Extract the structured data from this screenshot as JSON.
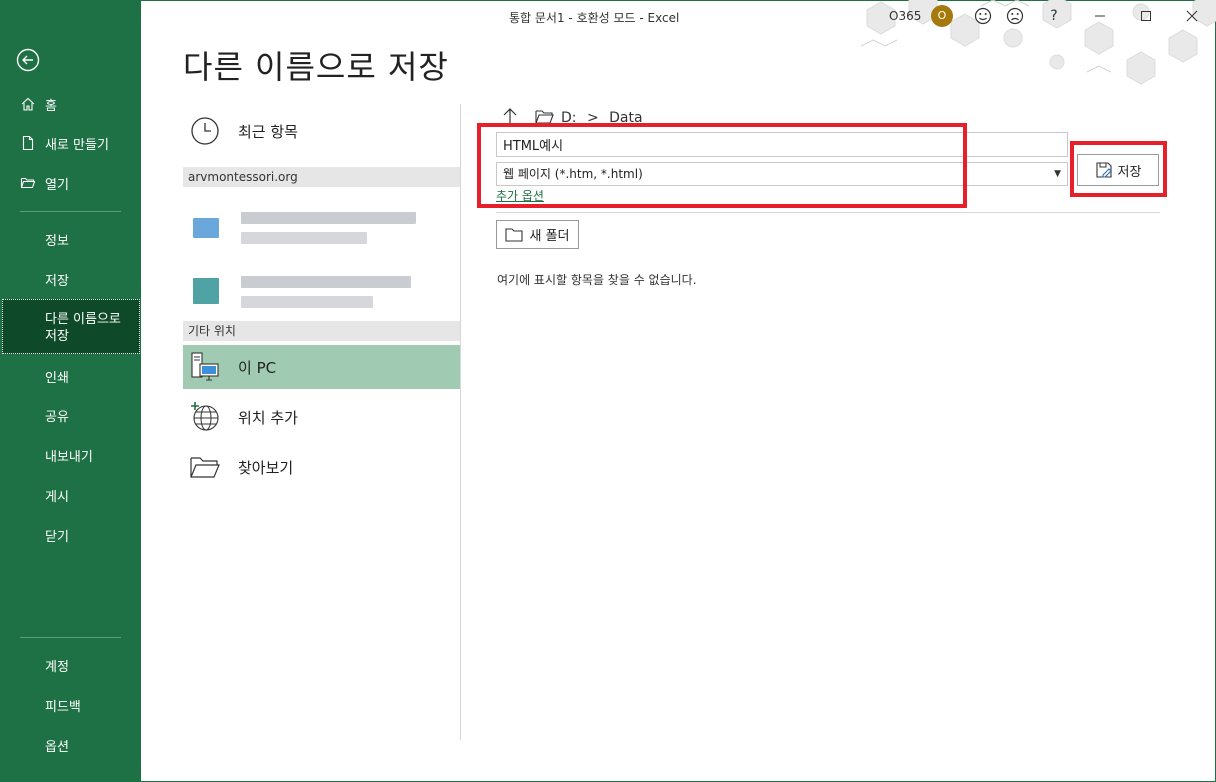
{
  "window": {
    "title": "통합 문서1  -  호환성 모드  -  Excel",
    "account_label": "O365",
    "avatar_initial": "O",
    "help_label": "?"
  },
  "sidebar": {
    "items_top": [
      {
        "label": "홈",
        "icon": "home-icon"
      },
      {
        "label": "새로 만들기",
        "icon": "new-document-icon"
      },
      {
        "label": "열기",
        "icon": "open-folder-icon"
      }
    ],
    "items_mid": [
      {
        "label": "정보"
      },
      {
        "label": "저장"
      },
      {
        "label": "다른 이름으로\n저장",
        "active": true
      },
      {
        "label": "인쇄"
      },
      {
        "label": "공유"
      },
      {
        "label": "내보내기"
      },
      {
        "label": "게시"
      },
      {
        "label": "닫기"
      }
    ],
    "items_bottom": [
      {
        "label": "계정"
      },
      {
        "label": "피드백"
      },
      {
        "label": "옵션"
      }
    ],
    "active_line1": "다른 이름으로",
    "active_line2": "저장"
  },
  "page": {
    "title": "다른 이름으로 저장"
  },
  "locations": {
    "recent": "최근 항목",
    "account_group": "arvmontessori.org",
    "other_group": "기타 위치",
    "this_pc": "이 PC",
    "add_place": "위치 추가",
    "browse": "찾아보기"
  },
  "save_pane": {
    "path_drive": "D:",
    "path_sep": ">",
    "path_folder": "Data",
    "filename_value": "HTML예시",
    "filetype_value": "웹 페이지 (*.htm, *.html)",
    "more_options": "추가 옵션",
    "save_button": "저장",
    "new_folder_button": "새 폴더",
    "empty_message": "여기에 표시할 항목을 찾을 수 없습니다."
  },
  "colors": {
    "sidebar_bg": "#1e7145",
    "sidebar_active": "#0e4a29",
    "selected_location": "#a0cbb2",
    "highlight_red": "#e5202a",
    "avatar": "#a6790d"
  }
}
